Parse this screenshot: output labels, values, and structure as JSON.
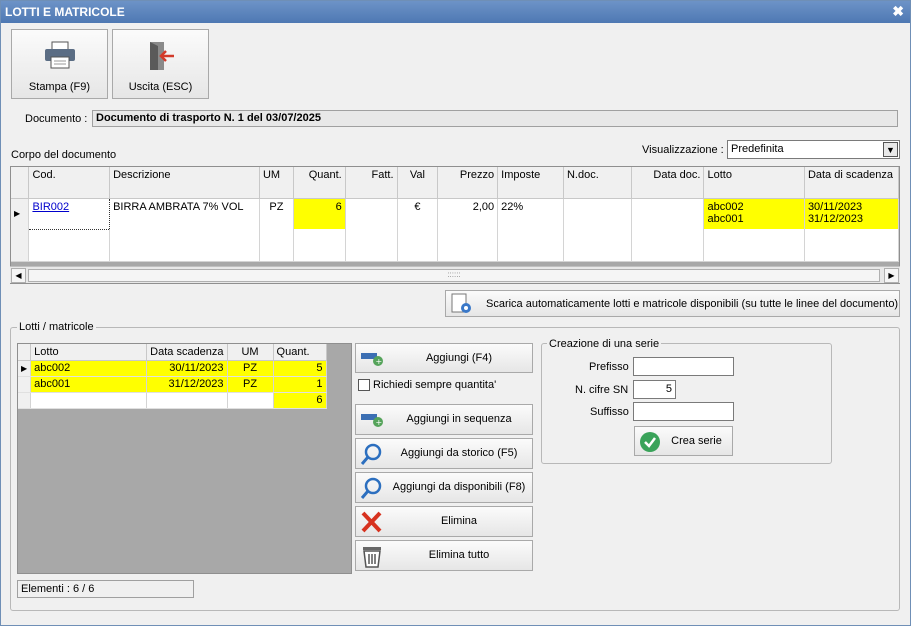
{
  "window": {
    "title": "LOTTI E MATRICOLE",
    "close_symbol": "✖"
  },
  "toolbar": {
    "print_label": "Stampa (F9)",
    "exit_label": "Uscita (ESC)"
  },
  "document": {
    "label": "Documento :",
    "value": "Documento di trasporto N. 1 del 03/07/2025"
  },
  "body_section_label": "Corpo del documento",
  "view": {
    "label": "Visualizzazione :",
    "selected": "Predefinita"
  },
  "main_grid": {
    "headers": [
      "Cod.",
      "Descrizione",
      "UM",
      "Quant.",
      "Fatt.",
      "Val",
      "Prezzo",
      "Imposte",
      "N.doc.",
      "Data doc.",
      "Lotto",
      "Data di scadenza"
    ],
    "row": {
      "code": "BIR002",
      "description": "BIRRA AMBRATA 7% VOL",
      "um": "PZ",
      "qty": "6",
      "fatt": "",
      "val": "€",
      "price": "2,00",
      "tax": "22%",
      "ndoc": "",
      "datadoc": "",
      "lots": [
        "abc002",
        "abc001"
      ],
      "expiries": [
        "30/11/2023",
        "31/12/2023"
      ]
    },
    "scroll_grip": "::::::"
  },
  "auto_download_button": "Scarica automaticamente lotti e matricole disponibili (su tutte le linee del documento)",
  "lots_section": {
    "label": "Lotti / matricole",
    "headers": [
      "Lotto",
      "Data scadenza",
      "UM",
      "Quant."
    ],
    "rows": [
      {
        "lot": "abc002",
        "expiry": "30/11/2023",
        "um": "PZ",
        "qty": "5"
      },
      {
        "lot": "abc001",
        "expiry": "31/12/2023",
        "um": "PZ",
        "qty": "1"
      }
    ],
    "total_qty": "6",
    "elements": "Elementi : 6 / 6"
  },
  "actions": {
    "add": "Aggiungi (F4)",
    "always_ask_qty": "Richiedi sempre quantita'",
    "add_sequence": "Aggiungi in sequenza",
    "add_history": "Aggiungi da storico (F5)",
    "add_available": "Aggiungi da disponibili (F8)",
    "delete": "Elimina",
    "delete_all": "Elimina tutto"
  },
  "series": {
    "title": "Creazione di una serie",
    "prefix_label": "Prefisso",
    "prefix_value": "",
    "digits_label": "N. cifre SN",
    "digits_value": "5",
    "suffix_label": "Suffisso",
    "suffix_value": "",
    "create_label": "Crea serie"
  }
}
